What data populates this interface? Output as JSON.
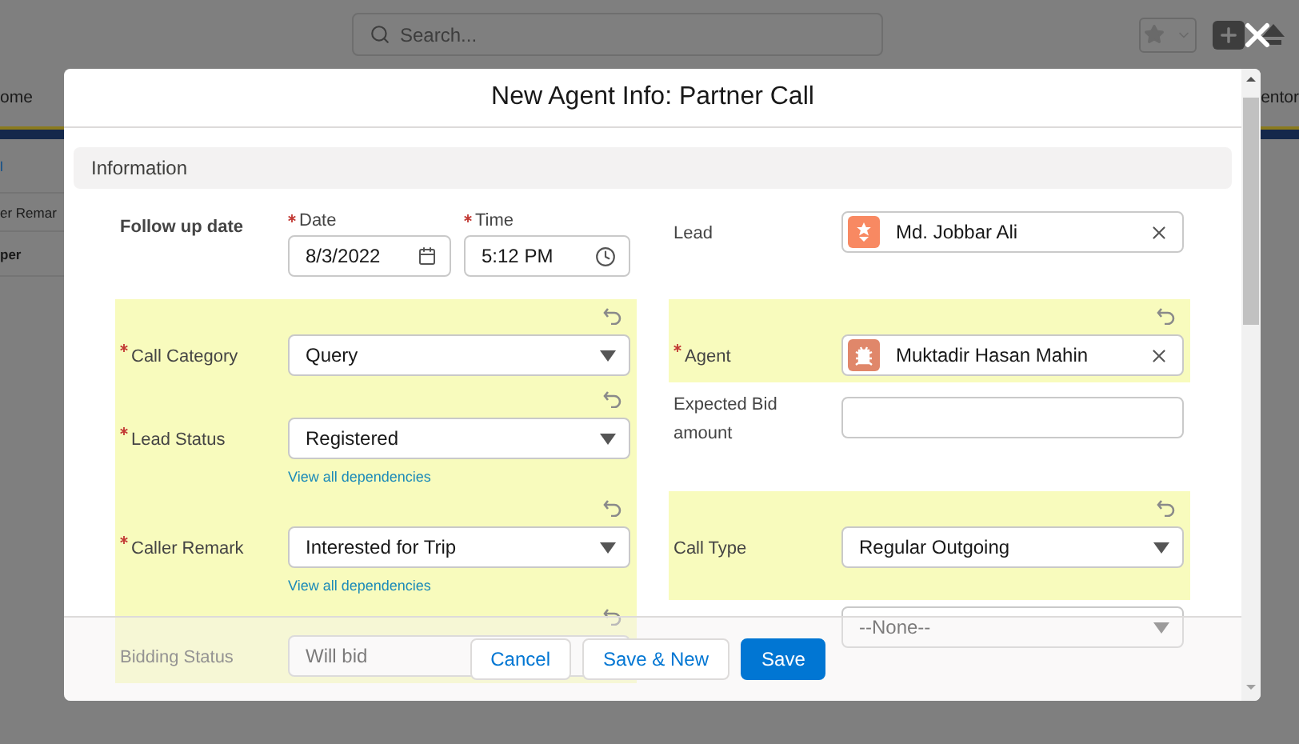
{
  "background": {
    "search_placeholder": "Search...",
    "nav_left": "ome",
    "nav_right": "entor",
    "side_items": [
      {
        "label": "l",
        "kind": "link"
      },
      {
        "label": "er Remar",
        "kind": "text"
      },
      {
        "label": "per",
        "kind": "bold"
      }
    ]
  },
  "modal": {
    "title": "New Agent Info: Partner Call",
    "section": "Information",
    "rows": [
      [
        {
          "kind": "datetime",
          "label": "Follow up date",
          "parts": [
            {
              "label": "Date",
              "required": true,
              "value": "8/3/2022"
            },
            {
              "label": "Time",
              "required": true,
              "value": "5:12 PM"
            }
          ]
        },
        {
          "kind": "lookup",
          "label": "Lead",
          "required": false,
          "highlighted": false,
          "value": "Md. Jobbar Ali",
          "color": "#f88962"
        }
      ],
      [
        {
          "kind": "picklist",
          "label": "Call Category",
          "required": true,
          "highlighted": true,
          "value": "Query"
        },
        {
          "kind": "lookup",
          "label": "Agent",
          "required": true,
          "highlighted": true,
          "value": "Muktadir Hasan Mahin",
          "color": "#e0876a"
        }
      ],
      [
        {
          "kind": "picklist",
          "label": "Lead Status",
          "required": true,
          "highlighted": true,
          "value": "Registered",
          "link": "View all dependencies"
        },
        {
          "kind": "text",
          "label": "Expected Bid amount",
          "required": false,
          "highlighted": false
        }
      ],
      [
        {
          "kind": "picklist",
          "label": "Caller Remark",
          "required": true,
          "highlighted": true,
          "value": "Interested for Trip",
          "link": "View all dependencies"
        },
        {
          "kind": "picklist",
          "label": "Call Type",
          "required": false,
          "highlighted": true,
          "value": "Regular Outgoing"
        }
      ],
      [
        {
          "kind": "picklist",
          "label": "Bidding Status",
          "required": false,
          "highlighted": true,
          "value": "Will bid"
        },
        {
          "kind": "picklist",
          "required": false,
          "highlighted": false,
          "value": "--None--"
        }
      ]
    ],
    "buttons": [
      {
        "label": "Cancel",
        "kind": "neutral"
      },
      {
        "label": "Save & New",
        "kind": "neutral"
      },
      {
        "label": "Save",
        "kind": "brand"
      }
    ]
  }
}
